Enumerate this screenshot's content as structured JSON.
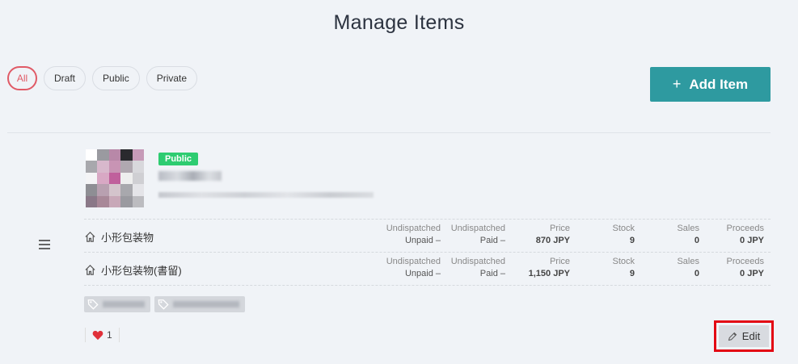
{
  "page": {
    "title": "Manage Items"
  },
  "filters": [
    {
      "label": "All",
      "active": true
    },
    {
      "label": "Draft"
    },
    {
      "label": "Public"
    },
    {
      "label": "Private"
    }
  ],
  "add_button": {
    "icon": "plus-icon",
    "label": "Add Item"
  },
  "item": {
    "status_badge": "Public",
    "badge_color": "#2ecc71",
    "menu_icon": "hamburger-icon",
    "variants": [
      {
        "name": "小形包装物",
        "icon": "home-icon",
        "undispatched_unpaid_label": "Undispatched",
        "unpaid": "Unpaid –",
        "undispatched_paid_label": "Undispatched",
        "paid": "Paid –",
        "price_label": "Price",
        "price": "870 JPY",
        "stock_label": "Stock",
        "stock": "9",
        "sales_label": "Sales",
        "sales": "0",
        "proceeds_label": "Proceeds",
        "proceeds": "0 JPY"
      },
      {
        "name": "小形包装物(書留)",
        "icon": "home-icon",
        "undispatched_unpaid_label": "Undispatched",
        "unpaid": "Unpaid –",
        "undispatched_paid_label": "Undispatched",
        "paid": "Paid –",
        "price_label": "Price",
        "price": "1,150 JPY",
        "stock_label": "Stock",
        "stock": "9",
        "sales_label": "Sales",
        "sales": "0",
        "proceeds_label": "Proceeds",
        "proceeds": "0 JPY"
      }
    ],
    "likes": {
      "icon": "heart-icon",
      "count": "1"
    },
    "edit_button": {
      "icon": "pencil-icon",
      "label": "Edit"
    }
  },
  "colors": {
    "accent": "#2e9aa0",
    "filter_active": "#e05a66",
    "heart": "#e0303a",
    "highlight_outline": "#e30613"
  }
}
